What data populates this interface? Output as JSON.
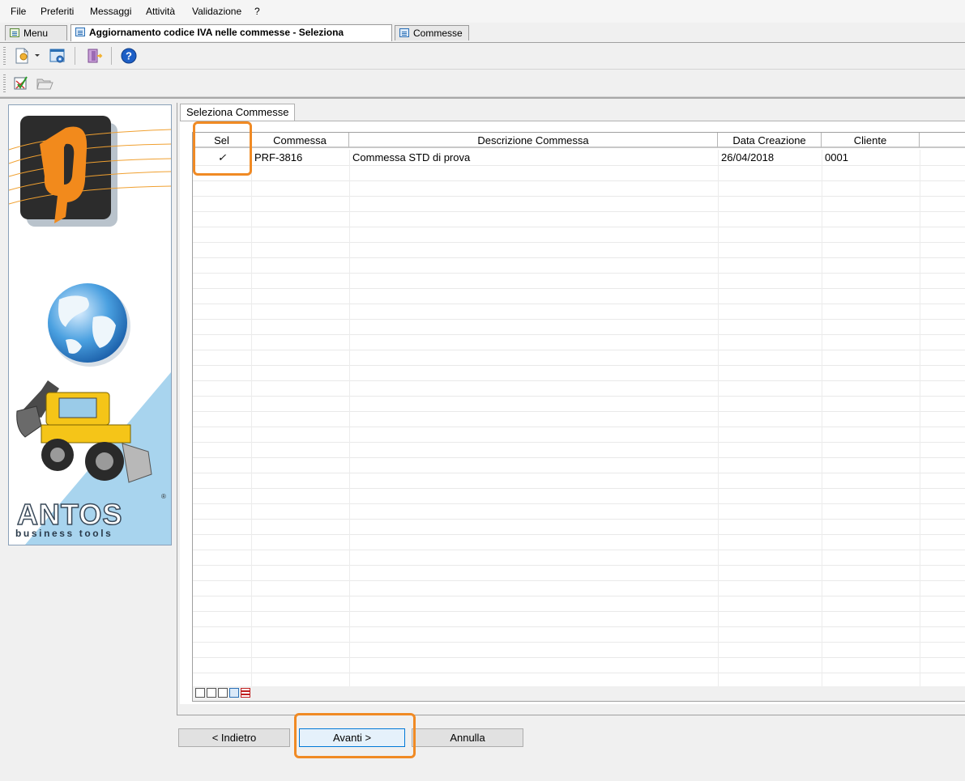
{
  "menu": [
    "File",
    "Preferiti",
    "Messaggi",
    "Attività",
    "Validazione",
    "?"
  ],
  "tabs": [
    {
      "label": "Menu"
    },
    {
      "label": "Aggiornamento codice IVA nelle commesse - Seleziona Commesse"
    },
    {
      "label": "Commesse"
    }
  ],
  "page_tab": "Seleziona Commesse",
  "grid": {
    "columns": [
      "Sel",
      "Commessa",
      "Descrizione Commessa",
      "Data Creazione",
      "Cliente"
    ],
    "rows": [
      {
        "sel": "✓",
        "commessa": "PRF-3816",
        "descrizione": "Commessa STD di prova",
        "data": "26/04/2018",
        "cliente": "0001"
      }
    ]
  },
  "buttons": {
    "back": "< Indietro",
    "next": "Avanti >",
    "cancel": "Annulla"
  },
  "logo": {
    "brand": "ANTOS",
    "tagline": "business tools"
  },
  "colors": {
    "highlight": "#f08a24",
    "accent": "#0078d7"
  }
}
